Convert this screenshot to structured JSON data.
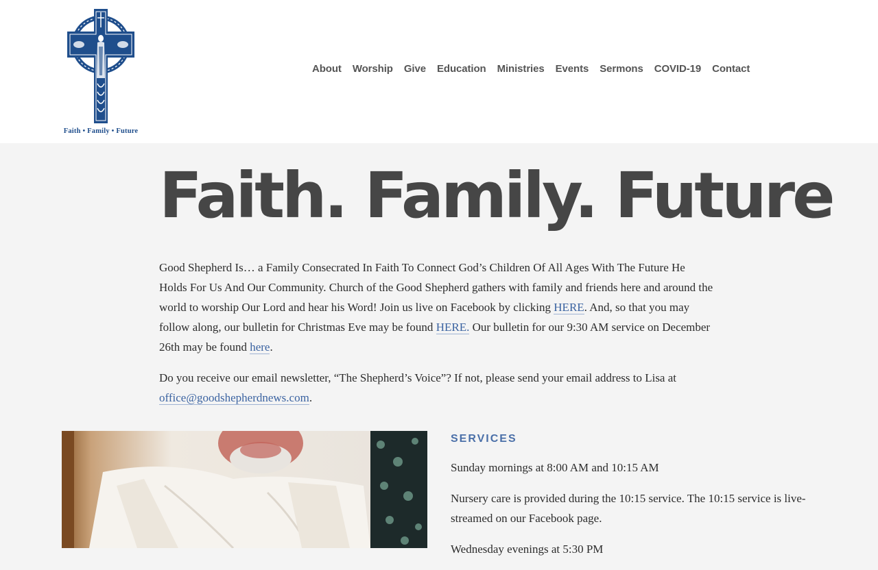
{
  "header": {
    "logo_tagline": "Faith • Family • Future",
    "nav": [
      {
        "label": "About"
      },
      {
        "label": "Worship"
      },
      {
        "label": "Give"
      },
      {
        "label": "Education"
      },
      {
        "label": "Ministries"
      },
      {
        "label": "Events"
      },
      {
        "label": "Sermons"
      },
      {
        "label": "COVID-19"
      },
      {
        "label": "Contact"
      }
    ]
  },
  "hero": {
    "title": "Faith. Family. Future"
  },
  "intro": {
    "p1_text_a": "Good Shepherd Is… a Family Consecrated In Faith To Connect God’s Children Of All Ages With The Future He Holds For Us And Our Community. Church of the Good Shepherd gathers with family and friends here and around the world to worship Our Lord and hear his Word! Join us live on Facebook by clicking ",
    "p1_link_1": "HERE",
    "p1_text_b": ".  And, so that you may follow along, our bulletin for Christmas Eve may be found ",
    "p1_link_2": "HERE.",
    "p1_text_c": "  Our bulletin for our 9:30 AM service on December 26th may be found ",
    "p1_link_3": "here",
    "p1_text_d": ".",
    "p2_text_a": " Do you receive our email newsletter, “The Shepherd’s Voice”?  If not, please send your email address to Lisa at ",
    "p2_link": "office@goodshepherdnews.com",
    "p2_text_b": "."
  },
  "services": {
    "heading": "SERVICES",
    "items": [
      {
        "text": "Sunday mornings at 8:00 AM and 10:15 AM"
      },
      {
        "text": "Nursery care is provided during the 10:15 service.  The 10:15 service is live-streamed on our Facebook page."
      },
      {
        "text": "Wednesday evenings at 5:30 PM"
      }
    ]
  },
  "colors": {
    "accent": "#3b63a1",
    "logo_blue": "#1f4e8c",
    "nav_text": "#555555",
    "title": "#464646",
    "background": "#f4f4f4"
  }
}
